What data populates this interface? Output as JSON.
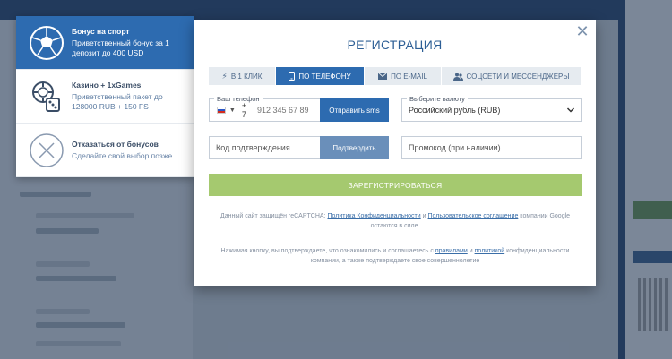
{
  "bonus_panel": {
    "items": [
      {
        "title": "Бонус на спорт",
        "desc": "Приветственный бонус за 1 депозит до 400 USD",
        "icon": "soccer-ball-icon"
      },
      {
        "title": "Казино + 1xGames",
        "desc": "Приветственный пакет до 128000 RUB + 150 FS",
        "icon": "casino-chips-icon"
      },
      {
        "title": "Отказаться от бонусов",
        "desc": "Сделайте свой выбор позже",
        "icon": "close-circle-icon"
      }
    ]
  },
  "modal": {
    "title": "РЕГИСТРАЦИЯ",
    "close_icon": "close-icon",
    "tabs": [
      {
        "label": "В 1 КЛИК",
        "icon": "lightning-icon"
      },
      {
        "label": "ПО ТЕЛЕФОНУ",
        "icon": "mobile-phone-icon"
      },
      {
        "label": "ПО E-MAIL",
        "icon": "envelope-icon"
      },
      {
        "label": "СОЦСЕТИ И МЕССЕНДЖЕРЫ",
        "icon": "users-icon"
      }
    ],
    "active_tab": 1,
    "phone": {
      "label": "Ваш телефон",
      "country_code": "+ 7",
      "placeholder": "912 345 67 89",
      "send_sms_label": "Отправить sms"
    },
    "currency": {
      "label": "Выберите валюту",
      "selected": "Российский рубль (RUB)"
    },
    "confirmation": {
      "placeholder": "Код подтверждения",
      "confirm_label": "Подтвердить"
    },
    "promo": {
      "placeholder": "Промокод (при наличии)"
    },
    "register_label": "ЗАРЕГИСТРИРОВАТЬСЯ",
    "recaptcha": {
      "prefix": "Данный сайт защищён reCAPTCHA:",
      "privacy_link": "Политика Конфиденциальности",
      "and": "и",
      "terms_link": "Пользовательское соглашение",
      "suffix": "компании Google остаются в силе."
    },
    "agreement": {
      "prefix": "Нажимая кнопку, вы подтверждаете, что ознакомились и соглашаетесь с",
      "rules_link": "правилами",
      "and": "и",
      "policy_link": "политикой",
      "suffix": "конфиденциальности компании, а также подтверждаете свое совершеннолетие"
    }
  },
  "colors": {
    "primary": "#2d6bb0",
    "register": "#a5c96f",
    "confirm": "#6a8fba",
    "title": "#2d5f96"
  }
}
